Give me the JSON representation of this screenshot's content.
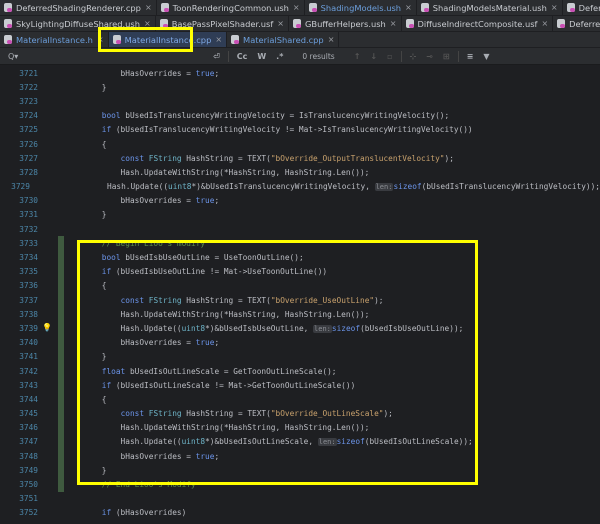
{
  "tabs": {
    "row1": [
      {
        "label": "DeferredShadingRenderer.cpp"
      },
      {
        "label": "ToonRenderingCommon.ush"
      },
      {
        "label": "ShadingModels.ush",
        "blue": true
      },
      {
        "label": "ShadingModelsMaterial.ush"
      },
      {
        "label": "DeferredShadingCommon.us"
      }
    ],
    "row2": [
      {
        "label": "SkyLightingDiffuseShared.ush"
      },
      {
        "label": "BasePassPixelShader.usf"
      },
      {
        "label": "GBufferHelpers.ush"
      },
      {
        "label": "DiffuseIndirectComposite.usf"
      },
      {
        "label": "DeferredLightPixelShaders.usf"
      }
    ],
    "row3": [
      {
        "label": "MaterialInstance.h",
        "blue": true
      },
      {
        "label": "MaterialInstance.cpp",
        "blue": true,
        "active": true
      },
      {
        "label": "MaterialShared.cpp",
        "blue": true
      }
    ],
    "close": "×"
  },
  "search": {
    "icon": "Q▾",
    "wrap": "⏎",
    "case": "Cc",
    "word": "W",
    "regex": ".*",
    "results": "0 results",
    "up": "↑",
    "down": "↓"
  },
  "code": [
    {
      "n": "3721",
      "t": "        bHasOverrides = true;"
    },
    {
      "n": "3722",
      "t": "    }"
    },
    {
      "n": "3723",
      "t": ""
    },
    {
      "n": "3724",
      "t": "    bool bUsedIsTranslucencyWritingVelocity = IsTranslucencyWritingVelocity();"
    },
    {
      "n": "3725",
      "t": "    if (bUsedIsTranslucencyWritingVelocity != Mat->IsTranslucencyWritingVelocity())"
    },
    {
      "n": "3726",
      "t": "    {"
    },
    {
      "n": "3727",
      "t": "        const FString HashString = TEXT(\"bOverride_OutputTranslucentVelocity\");"
    },
    {
      "n": "3728",
      "t": "        Hash.UpdateWithString(*HashString, HashString.Len());"
    },
    {
      "n": "3729",
      "t": "        Hash.Update((uint8*)&bUsedIsTranslucencyWritingVelocity, len:sizeof(bUsedIsTranslucencyWritingVelocity));"
    },
    {
      "n": "3730",
      "t": "        bHasOverrides = true;"
    },
    {
      "n": "3731",
      "t": "    }"
    },
    {
      "n": "3732",
      "t": ""
    },
    {
      "n": "3733",
      "t": "    // Begin Lioo's modify",
      "c": 1
    },
    {
      "n": "3734",
      "t": "    bool bUsedIsbUseOutLine = UseToonOutLine();",
      "c": 1
    },
    {
      "n": "3735",
      "t": "    if (bUsedIsbUseOutLine != Mat->UseToonOutLine())",
      "c": 1
    },
    {
      "n": "3736",
      "t": "    {",
      "c": 1
    },
    {
      "n": "3737",
      "t": "        const FString HashString = TEXT(\"bOverride_UseOutLine\");",
      "c": 1
    },
    {
      "n": "3738",
      "t": "        Hash.UpdateWithString(*HashString, HashString.Len());",
      "c": 1
    },
    {
      "n": "3739",
      "t": "        Hash.Update((uint8*)&bUsedIsbUseOutLine, len:sizeof(bUsedIsbUseOutLine));",
      "c": 1,
      "bulb": 1
    },
    {
      "n": "3740",
      "t": "        bHasOverrides = true;",
      "c": 1
    },
    {
      "n": "3741",
      "t": "    }",
      "c": 1
    },
    {
      "n": "3742",
      "t": "    float bUsedIsOutLineScale = GetToonOutLineScale();",
      "c": 1
    },
    {
      "n": "3743",
      "t": "    if (bUsedIsOutLineScale != Mat->GetToonOutLineScale())",
      "c": 1
    },
    {
      "n": "3744",
      "t": "    {",
      "c": 1
    },
    {
      "n": "3745",
      "t": "        const FString HashString = TEXT(\"bOverride_OutLineScale\");",
      "c": 1
    },
    {
      "n": "3746",
      "t": "        Hash.UpdateWithString(*HashString, HashString.Len());",
      "c": 1
    },
    {
      "n": "3747",
      "t": "        Hash.Update((uint8*)&bUsedIsOutLineScale, len:sizeof(bUsedIsOutLineScale));",
      "c": 1
    },
    {
      "n": "3748",
      "t": "        bHasOverrides = true;",
      "c": 1
    },
    {
      "n": "3749",
      "t": "    }",
      "c": 1
    },
    {
      "n": "3750",
      "t": "    // End Lioo's Modify",
      "c": 1
    },
    {
      "n": "3751",
      "t": ""
    },
    {
      "n": "3752",
      "t": "    if (bHasOverrides)"
    }
  ]
}
